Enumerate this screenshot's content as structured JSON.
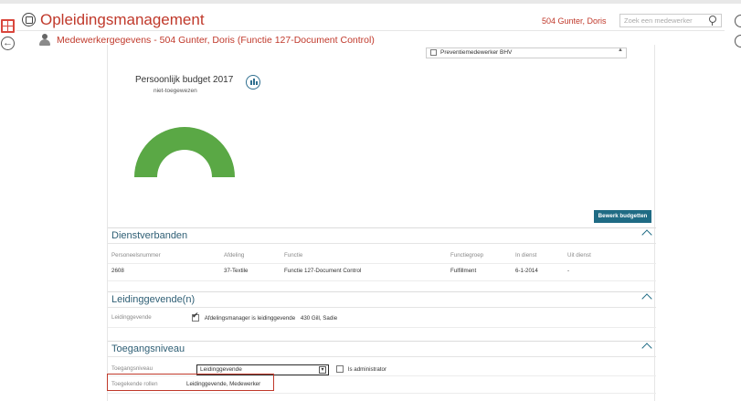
{
  "app": {
    "title": "Opleidingsmanagement",
    "user_name": "504 Gunter, Doris",
    "search_placeholder": "Zoek een medewerker",
    "accent_color": "#c0392b"
  },
  "subheader": {
    "title": "Medewerkergegevens - 504 Gunter, Doris (Functie 127-Document Control)"
  },
  "previous_field": {
    "option_label": "Preventiemedewerker BHV"
  },
  "budget": {
    "title": "Persoonlijk budget 2017",
    "status": "niet-toegewezen",
    "gauge_fill_fraction": 1.0,
    "gauge_color": "#5aa845",
    "edit_button": "Bewerk budgetten"
  },
  "dienstverbanden": {
    "title": "Dienstverbanden",
    "columns": [
      "Personeelsnummer",
      "Afdeling",
      "Functie",
      "Functiegroep",
      "In dienst",
      "Uit dienst"
    ],
    "rows": [
      [
        "2608",
        "37-Textile",
        "Functie 127-Document Control",
        "Fulfillment",
        "6-1-2014",
        "-"
      ]
    ]
  },
  "leidinggevende": {
    "title": "Leidinggevende(n)",
    "label": "Leidinggevende",
    "checkbox_text": "Afdelingsmanager is leidinggevende",
    "checked": true,
    "manager": "430 Gill, Sadie"
  },
  "toegang": {
    "title": "Toegangsniveau",
    "level_label": "Toegangsniveau",
    "level_value": "Leidinggevende",
    "admin_label": "Is administrator",
    "roles_label": "Toegekende rollen",
    "roles_value": "Leidinggevende, Medewerker"
  }
}
